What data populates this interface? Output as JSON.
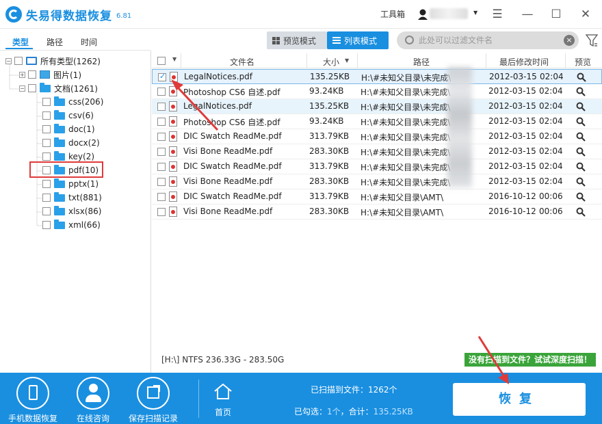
{
  "app": {
    "title": "失易得数据恢复",
    "version": "6.81"
  },
  "titlebar": {
    "tools_label": "工具箱",
    "minimize": "—",
    "maximize": "☐",
    "close": "✕",
    "menu": "☰"
  },
  "left_tabs": [
    "类型",
    "路径",
    "时间"
  ],
  "tree": {
    "root": "所有类型(1262)",
    "images": "图片(1)",
    "docs": "文档(1261)",
    "children": [
      "css(206)",
      "csv(6)",
      "doc(1)",
      "docx(2)",
      "key(2)",
      "pdf(10)",
      "pptx(1)",
      "txt(881)",
      "xlsx(86)",
      "xml(66)"
    ]
  },
  "toolbar": {
    "preview_mode": "预览模式",
    "list_mode": "列表模式"
  },
  "search": {
    "placeholder": "此处可以过滤文件名"
  },
  "table": {
    "headers": {
      "name": "文件名",
      "size": "大小",
      "path": "路径",
      "modified": "最后修改时间",
      "preview": "预览"
    },
    "rows": [
      {
        "name": "LegalNotices.pdf",
        "size": "135.25KB",
        "path": "H:\\#未知父目录\\未完成\\",
        "date": "2012-03-15",
        "time": "02:04",
        "checked": true
      },
      {
        "name": "Photoshop CS6 自述.pdf",
        "size": "93.24KB",
        "path": "H:\\#未知父目录\\未完成\\",
        "date": "2012-03-15",
        "time": "02:04",
        "checked": false
      },
      {
        "name": "LegalNotices.pdf",
        "size": "135.25KB",
        "path": "H:\\#未知父目录\\未完成\\",
        "date": "2012-03-15",
        "time": "02:04",
        "checked": false
      },
      {
        "name": "Photoshop CS6 自述.pdf",
        "size": "93.24KB",
        "path": "H:\\#未知父目录\\未完成\\",
        "date": "2012-03-15",
        "time": "02:04",
        "checked": false
      },
      {
        "name": "DIC Swatch ReadMe.pdf",
        "size": "313.79KB",
        "path": "H:\\#未知父目录\\未完成\\",
        "date": "2012-03-15",
        "time": "02:04",
        "checked": false
      },
      {
        "name": "Visi Bone ReadMe.pdf",
        "size": "283.30KB",
        "path": "H:\\#未知父目录\\未完成\\",
        "date": "2012-03-15",
        "time": "02:04",
        "checked": false
      },
      {
        "name": "DIC Swatch ReadMe.pdf",
        "size": "313.79KB",
        "path": "H:\\#未知父目录\\未完成\\",
        "date": "2012-03-15",
        "time": "02:04",
        "checked": false
      },
      {
        "name": "Visi Bone ReadMe.pdf",
        "size": "283.30KB",
        "path": "H:\\#未知父目录\\未完成\\",
        "date": "2012-03-15",
        "time": "02:04",
        "checked": false
      },
      {
        "name": "DIC Swatch ReadMe.pdf",
        "size": "313.79KB",
        "path": "H:\\#未知父目录\\AMT\\",
        "date": "2016-10-12",
        "time": "00:06",
        "checked": false
      },
      {
        "name": "Visi Bone ReadMe.pdf",
        "size": "283.30KB",
        "path": "H:\\#未知父目录\\AMT\\",
        "date": "2016-10-12",
        "time": "00:06",
        "checked": false
      }
    ]
  },
  "status": {
    "drive": "[H:\\] NTFS 236.33G - 283.50G",
    "deep_scan": "没有扫描到文件？试试深度扫描！"
  },
  "bottom": {
    "phone_recovery": "手机数据恢复",
    "online_consult": "在线咨询",
    "save_scan": "保存扫描记录",
    "home": "首页",
    "scanned": "已扫描到文件：1262个",
    "checked_label": "已勾选：",
    "checked_count": "1个",
    "total_label": "，合计：",
    "total_size": "135.25KB",
    "recover": "恢复"
  },
  "colors": {
    "accent": "#1a8fe0",
    "deep_scan": "#3aa43a",
    "annotation": "#e03a3a"
  }
}
